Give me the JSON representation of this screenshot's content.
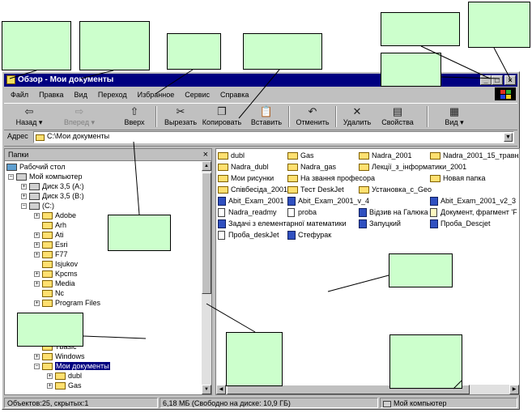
{
  "window": {
    "title": "Обзор - Мои документы",
    "buttons": {
      "minimize": "_",
      "maximize": "□",
      "close": "×"
    }
  },
  "menu": [
    "Файл",
    "Правка",
    "Вид",
    "Переход",
    "Избранное",
    "Сервис",
    "Справка"
  ],
  "toolbar": {
    "back": "Назад",
    "forward": "Вперед",
    "up": "Вверх",
    "cut": "Вырезать",
    "copy": "Копировать",
    "paste": "Вставить",
    "undo": "Отменить",
    "delete": "Удалить",
    "properties": "Свойства",
    "view": "Вид"
  },
  "address": {
    "label": "Адрес",
    "value": "C:\\Мои документы"
  },
  "folders_pane": {
    "title": "Папки",
    "close": "×",
    "tree": [
      "Рабочий стол",
      "Мой компьютер",
      "Диск 3,5 (A:)",
      "Диск 3,5 (B:)",
      "(C:)",
      "Adobe",
      "Arh",
      "Ati",
      "Esri",
      "F77",
      "Isjukov",
      "Kpcms",
      "Media",
      "Nc",
      "Program Files",
      "Tbasic",
      "Windows",
      "Мои документы",
      "dubl",
      "Gas"
    ]
  },
  "files": [
    "dubl",
    "Gas",
    "Nadra_2001",
    "Nadra_2001_15_травня",
    "Nadra_dubl",
    "Nadra_gas",
    "Лекції_з_інформатики_2001",
    "Мои рисунки",
    "На звання професора",
    "Новая папка",
    "Співбесіда_2001",
    "Тест DeskJet",
    "Установка_c_Geo",
    "Abit_Exam_2001",
    "Abit_Exam_2001_v_4",
    "Abit_Exam_2001_v2_3",
    "Nadra_readmy",
    "proba",
    "Відзив на Галюка",
    "Документ, фрагмент 'F",
    "Задачі з елементарної математики",
    "Запуцкий",
    "Проба_Descjet",
    "Проба_deskJet",
    "Стефурак"
  ],
  "status": {
    "objects": "Объектов:25, скрытых:1",
    "size": "6,18 МБ (Свободно на диске: 10,9 ГБ)",
    "location": "Мой компьютер"
  },
  "colors": {
    "callout": "#ccffcc",
    "titlebar": "#000080",
    "face": "#c0c0c0",
    "selection": "#000080"
  }
}
